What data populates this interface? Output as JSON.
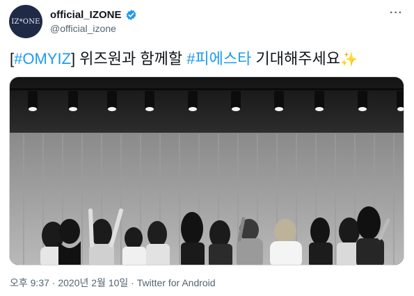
{
  "account": {
    "avatar_text": "IZ*ONE",
    "display_name": "official_IZONE",
    "handle": "@official_izone",
    "verified": true
  },
  "menu": {
    "more_label": "···"
  },
  "tweet": {
    "bracket_open": "[",
    "hashtag_1": "#OMYIZ",
    "bracket_close": "]",
    "text_middle": " 위즈원과 함께할 ",
    "hashtag_2": "#피에스타",
    "text_end": " 기대해주세요",
    "emoji": "✨"
  },
  "media": {
    "description_icon": "photo"
  },
  "meta": {
    "time": "오후 9:37",
    "separator": " · ",
    "date": "2020년 2월 10일",
    "separator2": " · ",
    "source": "Twitter for Android"
  },
  "colors": {
    "link": "#1d9bf0",
    "verified": "#1d9bf0",
    "secondary_text": "#536471"
  }
}
